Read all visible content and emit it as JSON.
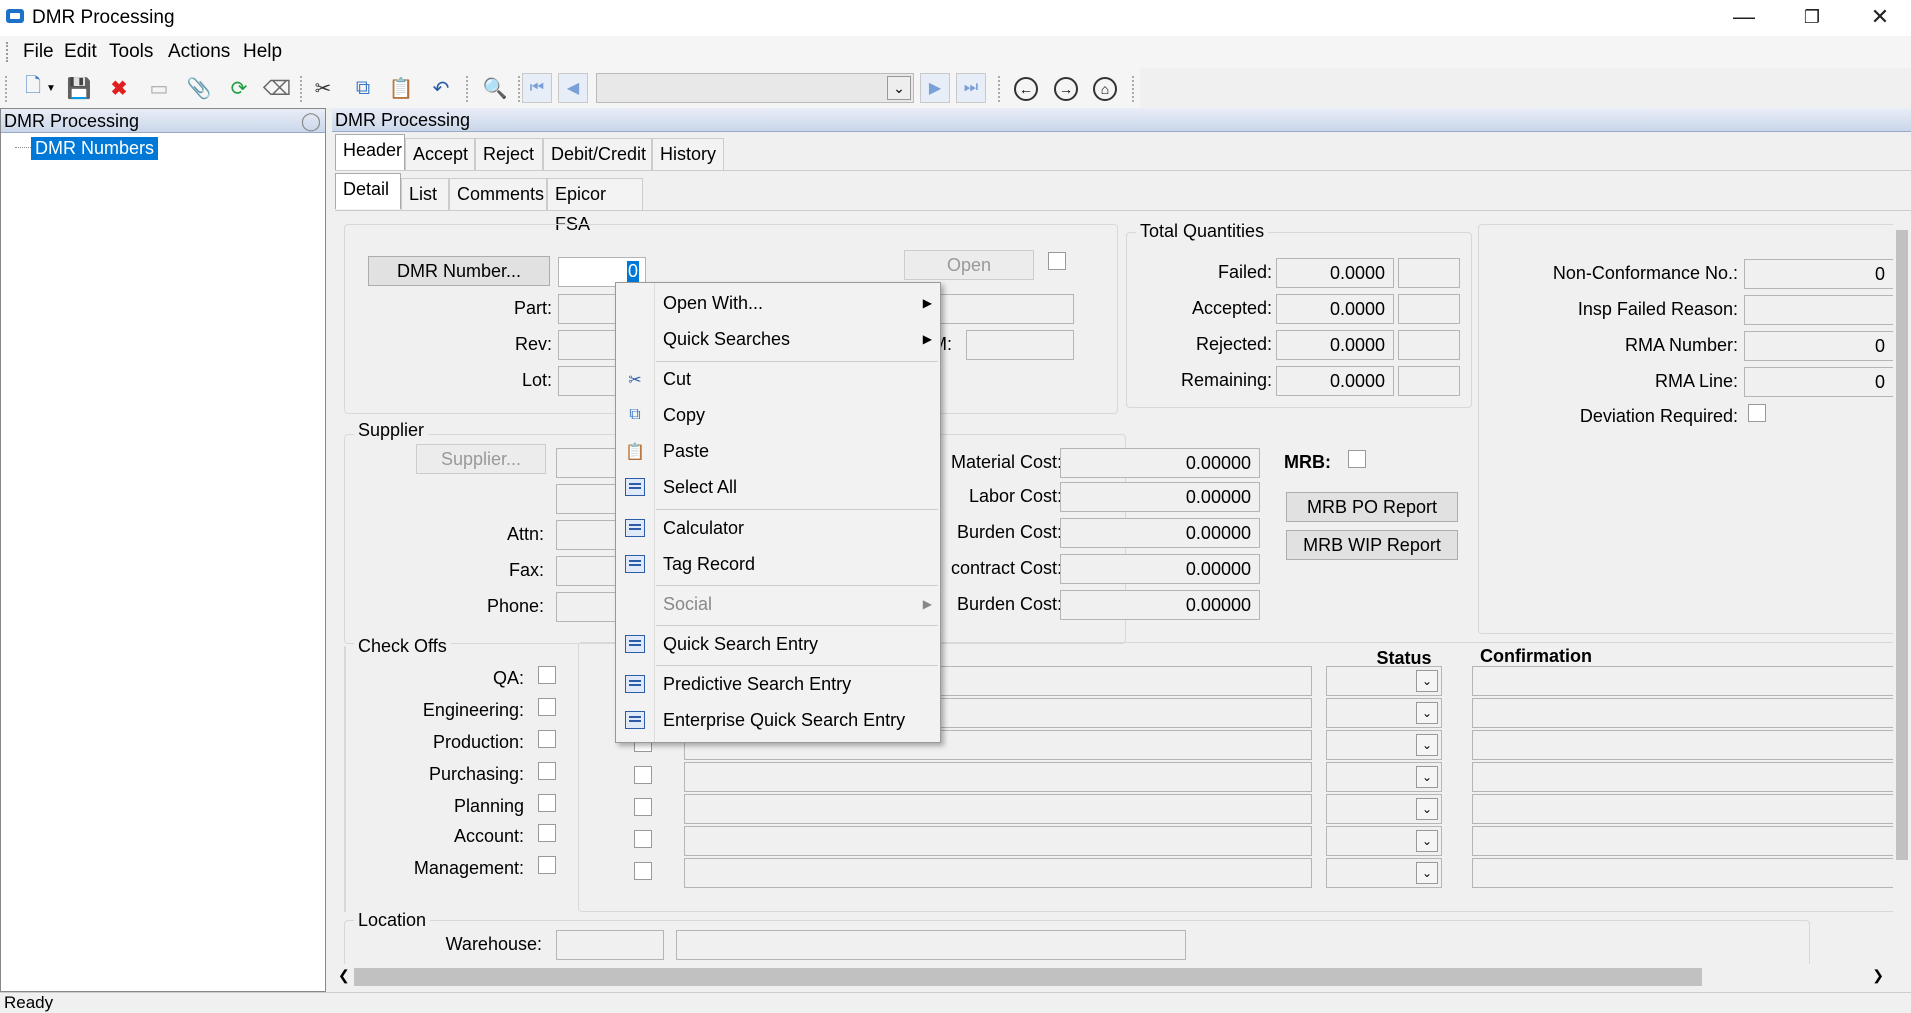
{
  "window": {
    "title": "DMR Processing"
  },
  "menu": [
    "File",
    "Edit",
    "Tools",
    "Actions",
    "Help"
  ],
  "left_panel": {
    "title": "DMR Processing",
    "tree_item": "DMR Numbers"
  },
  "main_panel": {
    "title": "DMR Processing"
  },
  "tabs_top": [
    "Header",
    "Accept",
    "Reject",
    "Debit/Credit",
    "History"
  ],
  "tabs_sub": [
    "Detail",
    "List",
    "Comments",
    "Epicor FSA"
  ],
  "header": {
    "dmr_button": "DMR Number...",
    "dmr_value": "0",
    "open_button": "Open",
    "part_label": "Part:",
    "rev_label": "Rev:",
    "lot_label": "Lot:",
    "um_label": "M:"
  },
  "total_quantities": {
    "title": "Total Quantities",
    "failed_label": "Failed:",
    "failed": "0.0000",
    "accepted_label": "Accepted:",
    "accepted": "0.0000",
    "rejected_label": "Rejected:",
    "rejected": "0.0000",
    "remaining_label": "Remaining:",
    "remaining": "0.0000"
  },
  "nonconf": {
    "ncr_label": "Non-Conformance No.:",
    "ncr": "0",
    "insp_label": "Insp Failed Reason:",
    "rma_label": "RMA Number:",
    "rma": "0",
    "rma_line_label": "RMA Line:",
    "rma_line": "0",
    "deviation_label": "Deviation Required:"
  },
  "supplier": {
    "title": "Supplier",
    "button": "Supplier...",
    "attn_label": "Attn:",
    "fax_label": "Fax:",
    "phone_label": "Phone:"
  },
  "costs": {
    "material_label": "Material Cost:",
    "material": "0.00000",
    "labor_label": "Labor Cost:",
    "labor": "0.00000",
    "burden_label": "Burden Cost:",
    "burden": "0.00000",
    "subcontract_label": "contract Cost:",
    "subcontract": "0.00000",
    "mtl_burden_label": "Burden Cost:",
    "mtl_burden": "0.00000"
  },
  "mrb": {
    "label": "MRB:",
    "po_report": "MRB PO Report",
    "wip_report": "MRB WIP Report"
  },
  "checkoffs": {
    "title": "Check Offs",
    "items": [
      "QA:",
      "Engineering:",
      "Production:",
      "Purchasing:",
      "Planning",
      "Account:",
      "Management:"
    ],
    "status_header": "Status",
    "confirmation_header": "Confirmation"
  },
  "location": {
    "title": "Location",
    "warehouse_label": "Warehouse:"
  },
  "context_menu": {
    "open_with": "Open With...",
    "quick_searches": "Quick Searches",
    "cut": "Cut",
    "copy": "Copy",
    "paste": "Paste",
    "select_all": "Select All",
    "calculator": "Calculator",
    "tag_record": "Tag Record",
    "social": "Social",
    "quick_search_entry": "Quick Search Entry",
    "predictive_search_entry": "Predictive Search Entry",
    "enterprise_quick_search_entry": "Enterprise Quick Search Entry"
  },
  "status_bar": "Ready"
}
